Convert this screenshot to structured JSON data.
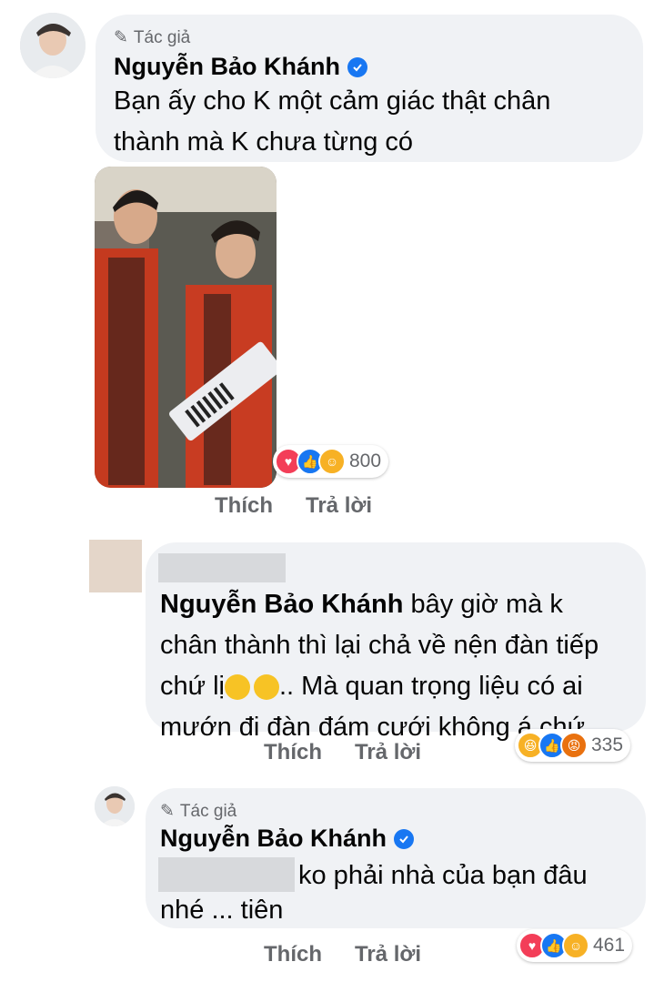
{
  "comment1": {
    "author_tag": "Tác giả",
    "name": "Nguyễn Bảo Khánh",
    "text_line1": "Bạn ấy cho K một cảm giác thật chân",
    "text_line2": "thành mà K chưa từng có",
    "reactions": [
      "love",
      "like",
      "care"
    ],
    "reaction_count": "800",
    "like_label": "Thích",
    "reply_label": "Trả lời"
  },
  "comment2": {
    "mention": "Nguyễn Bảo Khánh",
    "text_after_mention": "bây giờ mà k",
    "text_line2": "chân thành thì lại chả về nện đàn tiếp",
    "text_line3_a": "chứ lị",
    "text_line3_b": ".. Mà quan trọng liệu có ai",
    "text_line4": "mướn đi đàn đám cưới không á chứ..",
    "reactions": [
      "haha",
      "like",
      "angry"
    ],
    "reaction_count": "335",
    "like_label": "Thích",
    "reply_label": "Trả lời"
  },
  "comment3": {
    "author_tag": "Tác giả",
    "name": "Nguyễn Bảo Khánh",
    "text_line1": "ko phải nhà của bạn đâu",
    "text_line2": "nhé ... tiên",
    "reactions": [
      "love",
      "like",
      "care"
    ],
    "reaction_count": "461",
    "like_label": "Thích",
    "reply_label": "Trả lời"
  },
  "colors": {
    "bubble": "#f0f2f5",
    "verified": "#1877f2",
    "love": "#f33e58",
    "like": "#1877f2",
    "care": "#f7b125",
    "angry": "#e9710f",
    "haha": "#f7b125"
  }
}
